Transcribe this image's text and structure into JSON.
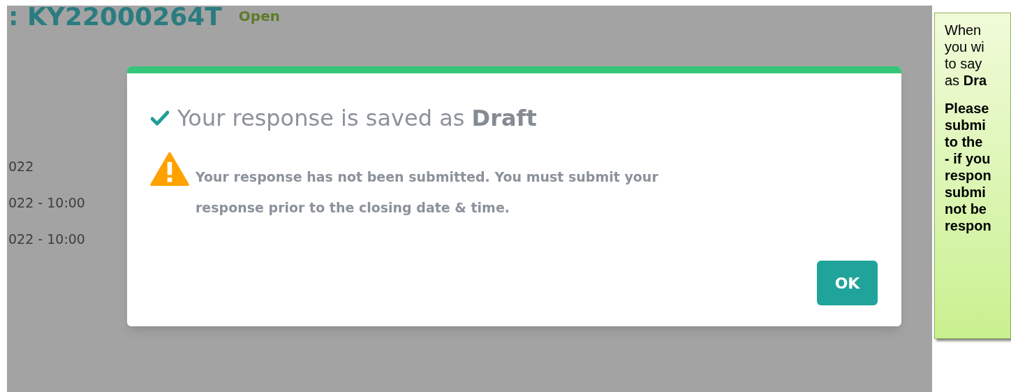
{
  "page": {
    "reference": ": KY22000264T",
    "status": "Open",
    "dates": [
      "022",
      "022 - 10:00",
      "022 - 10:00"
    ]
  },
  "dialog": {
    "title_prefix": "Your response is saved as",
    "title_emphasis": "Draft",
    "warning": "Your response has not been submitted. You must submit your response prior to the closing date & time.",
    "button": "OK"
  },
  "callout": {
    "paragraphs": [
      {
        "bold": false,
        "lines": [
          "When",
          "you wi",
          "to say",
          "as **Dra**"
        ]
      },
      {
        "bold": true,
        "lines": [
          "Please",
          "submi",
          "to the",
          "- if you",
          "respon",
          "submi",
          "not be",
          "respon"
        ]
      }
    ]
  }
}
